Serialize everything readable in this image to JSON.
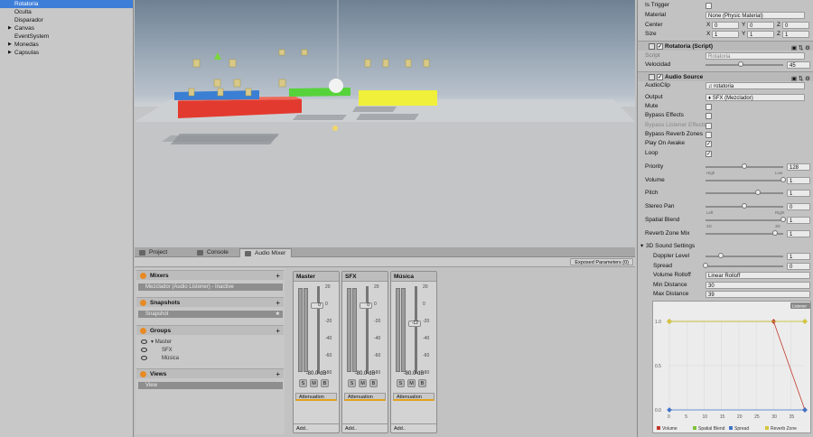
{
  "hierarchy": {
    "items": [
      {
        "label": "Rotatoria",
        "selected": true,
        "fold": false
      },
      {
        "label": "Oculta",
        "fold": false
      },
      {
        "label": "Disparador",
        "fold": false
      },
      {
        "label": "Canvas",
        "fold": true
      },
      {
        "label": "EventSystem",
        "fold": false
      },
      {
        "label": "Monedas",
        "fold": true
      },
      {
        "label": "Capsulas",
        "fold": true
      }
    ]
  },
  "tabs": [
    {
      "label": "Project"
    },
    {
      "label": "Console"
    },
    {
      "label": "Audio Mixer",
      "active": true
    }
  ],
  "mixer": {
    "exposed_label": "Exposed Parameters (0)",
    "mixers": {
      "title": "Mixers",
      "item": "Mezclador  (Audio Listener) - Inactive"
    },
    "snapshots": {
      "title": "Snapshots",
      "item": "Snapshot"
    },
    "groups": {
      "title": "Groups",
      "items": [
        "Master",
        "SFX",
        "Música"
      ]
    },
    "views": {
      "title": "Views",
      "item": "View"
    },
    "scale_labels": [
      "20",
      "0",
      "-20",
      "-40",
      "-60",
      "-80"
    ],
    "strips": [
      {
        "name": "Master",
        "db": "-80.0 dB",
        "knob": "0",
        "effect": "Attenuation",
        "add": "Add..",
        "s": "S",
        "m": "M",
        "b": "B"
      },
      {
        "name": "SFX",
        "db": "-80.0 dB",
        "knob": "0",
        "effect": "Attenuation",
        "add": "Add..",
        "s": "S",
        "m": "M",
        "b": "B"
      },
      {
        "name": "Música",
        "db": "-80.0 dB",
        "knob": "-12",
        "effect": "Attenuation",
        "add": "Add..",
        "s": "S",
        "m": "M",
        "b": "B"
      }
    ]
  },
  "inspector": {
    "collider": {
      "is_trigger": "Is Trigger",
      "material_label": "Material",
      "material_value": "None (Physic Material)",
      "center_label": "Center",
      "size_label": "Size",
      "center": {
        "x": "0",
        "y": "0",
        "z": "0"
      },
      "size": {
        "x": "1",
        "y": "1",
        "z": "1"
      },
      "axis": {
        "x": "X",
        "y": "Y",
        "z": "Z"
      }
    },
    "script_component": {
      "title": "Rotatoria (Script)",
      "script_label": "Script",
      "script_value": "Rotatoria",
      "velocity_label": "Velocidad",
      "velocity_value": "45",
      "velocity_fraction": 0.45
    },
    "audio_source": {
      "title": "Audio Source",
      "clip_label": "AudioClip",
      "clip_value": "rotatoria",
      "output_label": "Output",
      "output_value": "SFX (Mezclador)",
      "checkboxes": [
        {
          "label": "Mute",
          "checked": false
        },
        {
          "label": "Bypass Effects",
          "checked": false
        },
        {
          "label": "Bypass Listener Effects",
          "checked": false,
          "disabled": true
        },
        {
          "label": "Bypass Reverb Zones",
          "checked": false
        },
        {
          "label": "Play On Awake",
          "checked": true
        },
        {
          "label": "Loop",
          "checked": true
        }
      ],
      "sliders": [
        {
          "label": "Priority",
          "value": "128",
          "fraction": 0.5,
          "min_label": "High",
          "max_label": "Low"
        },
        {
          "label": "Volume",
          "value": "1",
          "fraction": 1.0
        },
        {
          "label": "Pitch",
          "value": "1",
          "fraction": 0.67
        },
        {
          "label": "Stereo Pan",
          "value": "0",
          "fraction": 0.5,
          "min_label": "Left",
          "max_label": "Right"
        },
        {
          "label": "Spatial Blend",
          "value": "1",
          "fraction": 1.0,
          "min_label": "2D",
          "max_label": "3D"
        },
        {
          "label": "Reverb Zone Mix",
          "value": "1",
          "fraction": 0.9
        }
      ],
      "settings3d": {
        "title": "3D Sound Settings",
        "doppler_label": "Doppler Level",
        "doppler_value": "1",
        "doppler_fraction": 0.2,
        "spread_label": "Spread",
        "spread_value": "0",
        "spread_fraction": 0.0,
        "rolloff_label": "Volume Rolloff",
        "rolloff_value": "Linear Rolloff",
        "min_label": "Min Distance",
        "min_value": "30",
        "max_label": "Max Distance",
        "max_value": "39"
      }
    }
  },
  "chart_data": {
    "type": "line",
    "title": "",
    "badge": "Listener",
    "x": [
      0,
      5,
      10,
      15,
      20,
      25,
      30,
      35,
      40
    ],
    "ylim": [
      0,
      1
    ],
    "y_ticks": [
      "1.0",
      "0.5",
      "0.0"
    ],
    "x_ticks": [
      "0",
      "5",
      "10",
      "15",
      "20",
      "25",
      "30",
      "35"
    ],
    "series": [
      {
        "name": "Volume",
        "color": "#c0392b",
        "points": [
          [
            0,
            1
          ],
          [
            30,
            1
          ],
          [
            39,
            0
          ]
        ]
      },
      {
        "name": "Spatial Blend",
        "color": "#7cc236",
        "points": [
          [
            0,
            1
          ],
          [
            39,
            1
          ]
        ]
      },
      {
        "name": "Spread",
        "color": "#3f73c8",
        "points": [
          [
            0,
            0
          ],
          [
            39,
            0
          ]
        ]
      },
      {
        "name": "Reverb Zone",
        "color": "#d6c43d",
        "points": [
          [
            0,
            1
          ],
          [
            39,
            1
          ]
        ]
      }
    ]
  }
}
